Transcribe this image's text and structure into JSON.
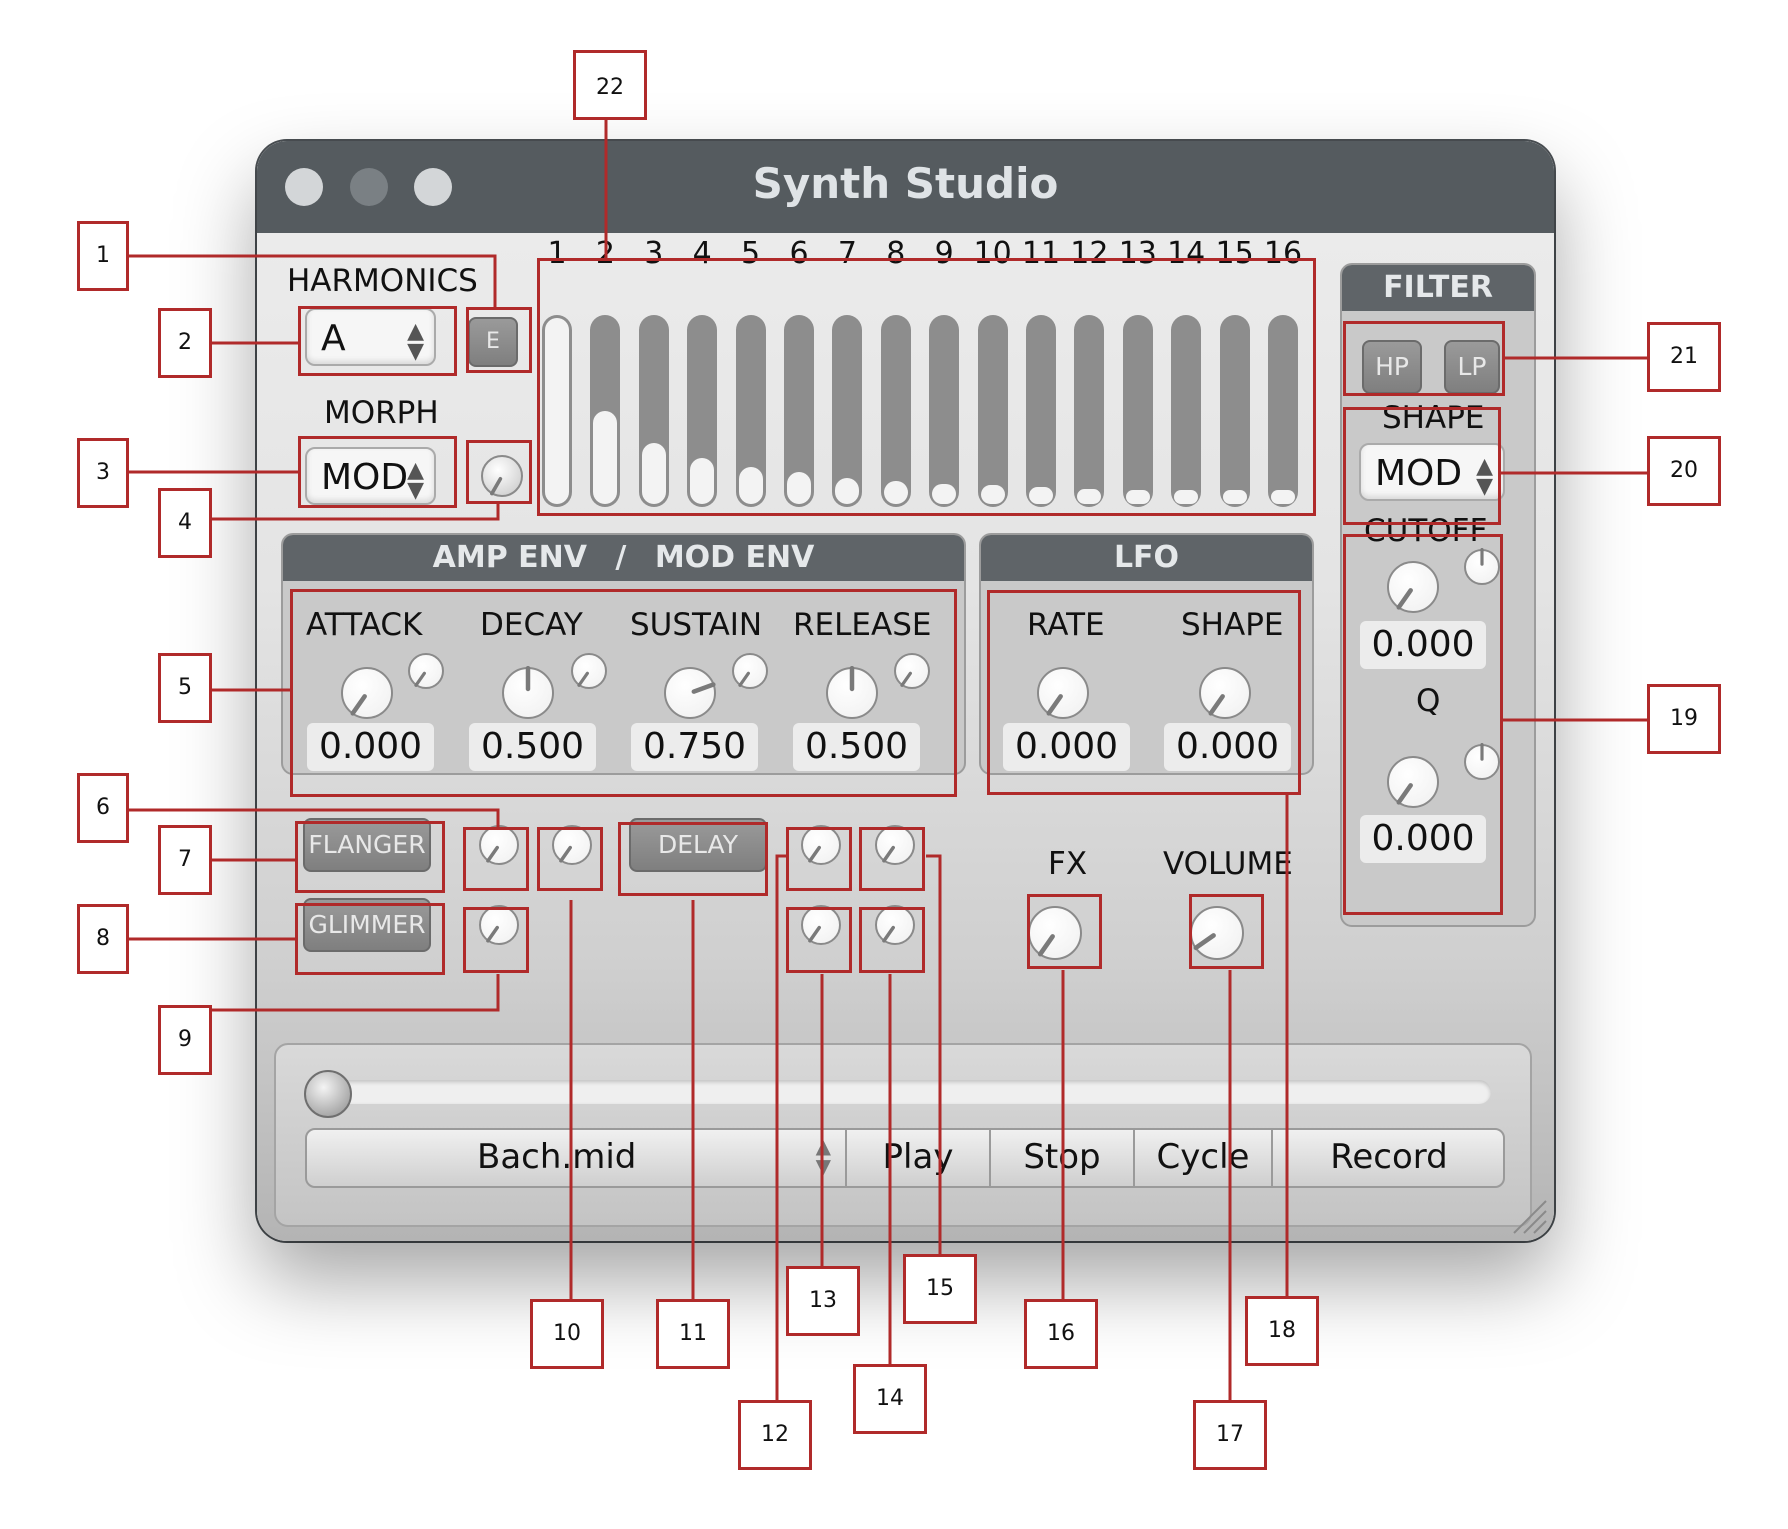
{
  "window": {
    "title": "Synth Studio"
  },
  "harmonics": {
    "label": "HARMONICS",
    "select_value": "A",
    "edit_button": "E",
    "numbers": [
      "1",
      "2",
      "3",
      "4",
      "5",
      "6",
      "7",
      "8",
      "9",
      "10",
      "11",
      "12",
      "13",
      "14",
      "15",
      "16"
    ],
    "levels": [
      1.0,
      0.5,
      0.33,
      0.25,
      0.2,
      0.17,
      0.14,
      0.125,
      0.11,
      0.1,
      0.09,
      0.083,
      0.077,
      0.071,
      0.067,
      0.063
    ]
  },
  "morph": {
    "label": "MORPH",
    "select_value": "MOD"
  },
  "amp_env": {
    "title_left": "AMP ENV",
    "title_sep": "/",
    "title_right": "MOD ENV",
    "controls": [
      {
        "label": "ATTACK",
        "value": "0.000"
      },
      {
        "label": "DECAY",
        "value": "0.500"
      },
      {
        "label": "SUSTAIN",
        "value": "0.750"
      },
      {
        "label": "RELEASE",
        "value": "0.500"
      }
    ]
  },
  "lfo": {
    "title": "LFO",
    "controls": [
      {
        "label": "RATE",
        "value": "0.000"
      },
      {
        "label": "SHAPE",
        "value": "0.000"
      }
    ]
  },
  "filter": {
    "title": "FILTER",
    "hp": "HP",
    "lp": "LP",
    "shape_label": "SHAPE",
    "shape_value": "MOD",
    "cutoff_label": "CUTOFF",
    "cutoff_value": "0.000",
    "q_label": "Q",
    "q_value": "0.000"
  },
  "fx": {
    "flanger": "FLANGER",
    "glimmer": "GLIMMER",
    "delay": "DELAY",
    "fx_label": "FX",
    "volume_label": "VOLUME"
  },
  "transport": {
    "file": "Bach.mid",
    "play": "Play",
    "stop": "Stop",
    "cycle": "Cycle",
    "record": "Record",
    "position": 0.0
  },
  "callouts": [
    "1",
    "2",
    "3",
    "4",
    "5",
    "6",
    "7",
    "8",
    "9",
    "10",
    "11",
    "12",
    "13",
    "14",
    "15",
    "16",
    "17",
    "18",
    "19",
    "20",
    "21",
    "22"
  ],
  "colors": {
    "annotation": "#b02a2a",
    "titlebar": "#555b5f",
    "panel_header": "#5f6468"
  }
}
